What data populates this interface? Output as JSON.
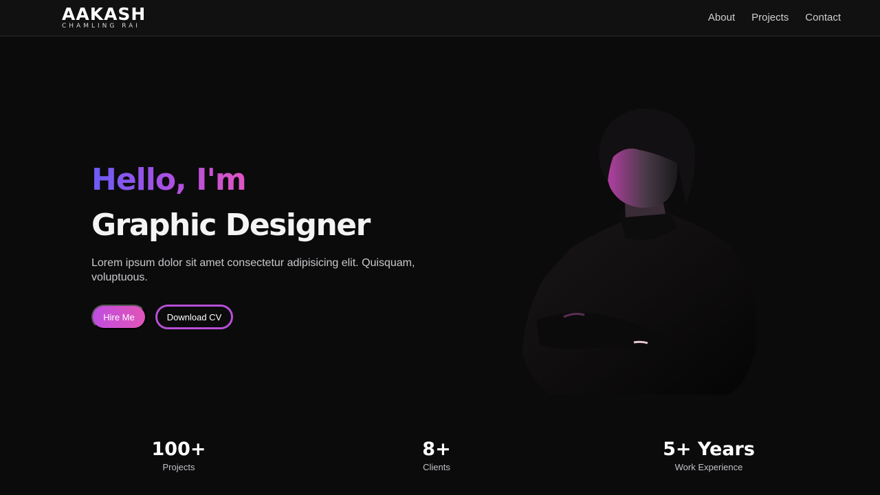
{
  "brand": {
    "name": "AAKASH",
    "tagline": "CHAMLING RAI"
  },
  "nav": {
    "links": [
      "About",
      "Projects",
      "Contact"
    ]
  },
  "hero": {
    "greeting": "Hello, I'm",
    "role": "Graphic Designer",
    "intro": "Lorem ipsum dolor sit amet consectetur adipisicing elit. Quisquam, voluptuous.",
    "primary_button": "Hire Me",
    "secondary_button": "Download CV"
  },
  "stats": [
    {
      "value": "100+",
      "label": "Projects"
    },
    {
      "value": "8+",
      "label": "Clients"
    },
    {
      "value": "5+ Years",
      "label": "Work Experience"
    }
  ],
  "colors": {
    "background": "#0b0b0c",
    "navbar": "#111112",
    "accent_start": "#6a5cf6",
    "accent_mid": "#b04fe0",
    "accent_end": "#e055c2"
  }
}
